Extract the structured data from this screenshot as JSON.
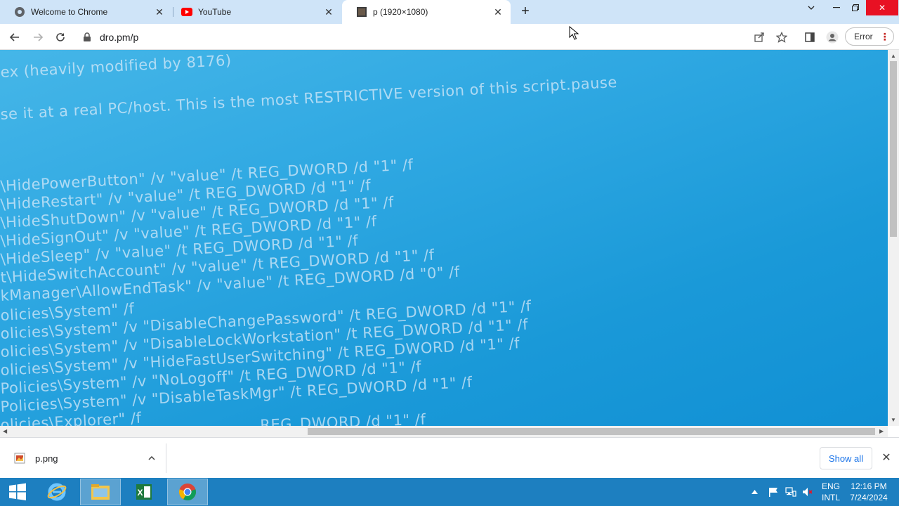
{
  "tabs": [
    {
      "title": "Welcome to Chrome",
      "favicon": "chrome-icon"
    },
    {
      "title": "YouTube",
      "favicon": "youtube-icon"
    },
    {
      "title": "p (1920×1080)",
      "favicon": "image-icon",
      "active": true
    }
  ],
  "toolbar": {
    "url": "dro.pm/p",
    "error_label": "Error"
  },
  "content": {
    "lines": [
      "ex (heavily modified by 8176)",
      "se it at a real PC/host. This is the most RESTRICTIVE version of this script.pause",
      "\\HidePowerButton\" /v \"value\" /t REG_DWORD /d \"1\" /f",
      "\\HideRestart\" /v \"value\" /t REG_DWORD /d \"1\" /f",
      "\\HideShutDown\" /v \"value\" /t REG_DWORD /d \"1\" /f",
      "\\HideSignOut\" /v \"value\" /t REG_DWORD /d \"1\" /f",
      "\\HideSleep\" /v \"value\" /t REG_DWORD /d \"1\" /f",
      "t\\HideSwitchAccount\" /v \"value\" /t REG_DWORD /d \"1\" /f",
      "kManager\\AllowEndTask\" /v \"value\" /t REG_DWORD /d \"0\" /f",
      "olicies\\System\" /f",
      "olicies\\System\" /v \"DisableChangePassword\" /t REG_DWORD /d \"1\" /f",
      "olicies\\System\" /v \"DisableLockWorkstation\" /t REG_DWORD /d \"1\" /f",
      "olicies\\System\" /v \"HideFastUserSwitching\" /t REG_DWORD /d \"1\" /f",
      "Policies\\System\" /v \"NoLogoff\" /t REG_DWORD /d \"1\" /f",
      "Policies\\System\" /v \"DisableTaskMgr\" /t REG_DWORD /d \"1\" /f",
      "olicies\\Explorer\" /f",
      "REG_DWORD /d \"1\" /f"
    ]
  },
  "downloads": {
    "item_name": "p.png",
    "show_all_label": "Show all"
  },
  "taskbar": {
    "apps": [
      "start-icon",
      "internet-explorer-icon",
      "file-explorer-icon",
      "excel-icon",
      "chrome-icon"
    ],
    "lang_top": "ENG",
    "lang_bottom": "INTL",
    "time": "12:16 PM",
    "date": "7/24/2024"
  },
  "colors": {
    "tabstrip": "#cfe4f8",
    "content_bg": "#2fa8e2",
    "taskbar": "#1d7fc0",
    "close_red": "#e81123",
    "link_blue": "#1a73e8"
  }
}
